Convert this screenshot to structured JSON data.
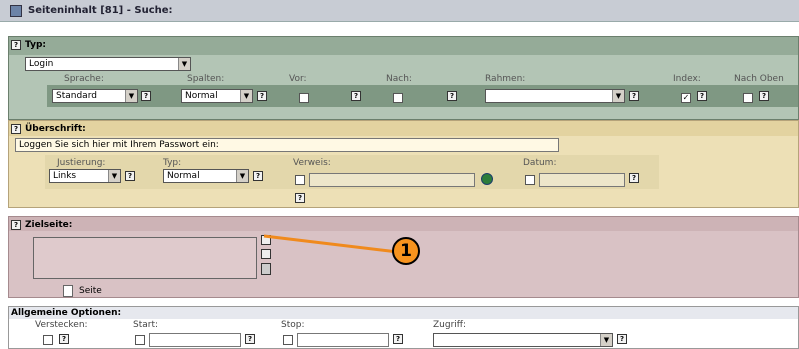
{
  "topbar": {
    "title": "Seiteninhalt [81] - Suche:"
  },
  "typ": {
    "heading": "Typ:",
    "value": "Login",
    "labels": [
      "Sprache:",
      "Spalten:",
      "Vor:",
      "Nach:",
      "Rahmen:",
      "Index:",
      "Nach Oben"
    ],
    "sprache": "Standard",
    "spalten": "Normal",
    "index_checked": "✓"
  },
  "ueberschrift": {
    "heading": "Überschrift:",
    "text": "Loggen Sie sich hier mit Ihrem Passwort ein:",
    "labels": [
      "Justierung:",
      "Typ:",
      "Verweis:",
      "Datum:"
    ],
    "justierung": "Links",
    "typ": "Normal"
  },
  "zielseite": {
    "heading": "Zielseite:",
    "page_label": "Seite"
  },
  "callout": {
    "number": "1"
  },
  "optionen": {
    "heading": "Allgemeine Optionen:",
    "labels": [
      "Verstecken:",
      "Start:",
      "Stop:",
      "Zugriff:"
    ]
  },
  "help_glyph": "?"
}
